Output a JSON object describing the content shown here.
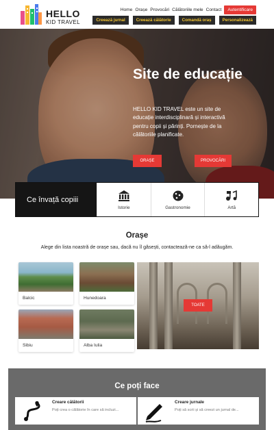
{
  "brand": {
    "name": "HELLO",
    "tagline": "KID TRAVEL"
  },
  "nav": {
    "links": [
      "Home",
      "Orașe",
      "Provocări",
      "Călătoriile mele",
      "Contact"
    ],
    "auth": "Autentificare",
    "sub": [
      "Creează jurnal",
      "Creează călătorie",
      "Comandă oraș",
      "Personalizează"
    ]
  },
  "hero": {
    "title": "Site de educație",
    "text": "HELLO KID TRAVEL este un site de educație interdisciplinară și interactivă pentru copii și părinți. Pornește de la călătoriile planificate.",
    "btn_orase": "ORAȘE",
    "btn_provocari": "PROVOCĂRI"
  },
  "learn": {
    "title": "Ce învață copiii",
    "items": [
      {
        "label": "Istorie",
        "icon": "columns-icon"
      },
      {
        "label": "Gastronomie",
        "icon": "cookie-icon"
      },
      {
        "label": "Artă",
        "icon": "music-icon"
      }
    ]
  },
  "orase": {
    "title": "Orașe",
    "subtitle": "Alege din lista noastră de orașe sau, dacă nu îl găsești, contactează-ne ca să-l adăugăm.",
    "cities": [
      "Balcic",
      "Hunedoara",
      "Sibiu",
      "Alba Iulia"
    ],
    "btn_toate": "TOATE"
  },
  "poti": {
    "title": "Ce poți face",
    "cards": [
      {
        "title": "Creare călătorii",
        "desc": "Poți crea o călătorie în care să incluzi..."
      },
      {
        "title": "Creare jurnale",
        "desc": "Poți să scrii și să creezi un jurnal de..."
      }
    ]
  },
  "colors": {
    "accent": "#e53935",
    "nav_dark": "#2a2a2a",
    "nav_gold": "#f4c430",
    "dark_panel": "#151515",
    "section_gray": "#6a6a6a"
  }
}
